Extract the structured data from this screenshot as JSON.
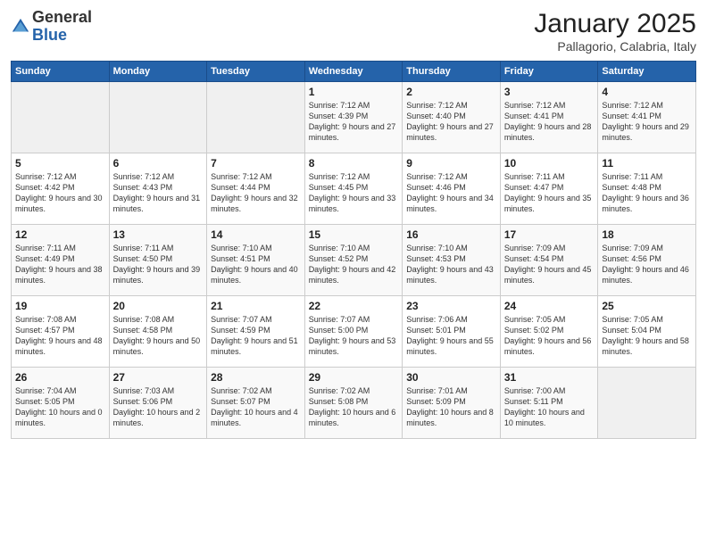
{
  "logo": {
    "general": "General",
    "blue": "Blue"
  },
  "header": {
    "month": "January 2025",
    "location": "Pallagorio, Calabria, Italy"
  },
  "weekdays": [
    "Sunday",
    "Monday",
    "Tuesday",
    "Wednesday",
    "Thursday",
    "Friday",
    "Saturday"
  ],
  "weeks": [
    [
      {
        "day": "",
        "info": ""
      },
      {
        "day": "",
        "info": ""
      },
      {
        "day": "",
        "info": ""
      },
      {
        "day": "1",
        "info": "Sunrise: 7:12 AM\nSunset: 4:39 PM\nDaylight: 9 hours\nand 27 minutes."
      },
      {
        "day": "2",
        "info": "Sunrise: 7:12 AM\nSunset: 4:40 PM\nDaylight: 9 hours\nand 27 minutes."
      },
      {
        "day": "3",
        "info": "Sunrise: 7:12 AM\nSunset: 4:41 PM\nDaylight: 9 hours\nand 28 minutes."
      },
      {
        "day": "4",
        "info": "Sunrise: 7:12 AM\nSunset: 4:41 PM\nDaylight: 9 hours\nand 29 minutes."
      }
    ],
    [
      {
        "day": "5",
        "info": "Sunrise: 7:12 AM\nSunset: 4:42 PM\nDaylight: 9 hours\nand 30 minutes."
      },
      {
        "day": "6",
        "info": "Sunrise: 7:12 AM\nSunset: 4:43 PM\nDaylight: 9 hours\nand 31 minutes."
      },
      {
        "day": "7",
        "info": "Sunrise: 7:12 AM\nSunset: 4:44 PM\nDaylight: 9 hours\nand 32 minutes."
      },
      {
        "day": "8",
        "info": "Sunrise: 7:12 AM\nSunset: 4:45 PM\nDaylight: 9 hours\nand 33 minutes."
      },
      {
        "day": "9",
        "info": "Sunrise: 7:12 AM\nSunset: 4:46 PM\nDaylight: 9 hours\nand 34 minutes."
      },
      {
        "day": "10",
        "info": "Sunrise: 7:11 AM\nSunset: 4:47 PM\nDaylight: 9 hours\nand 35 minutes."
      },
      {
        "day": "11",
        "info": "Sunrise: 7:11 AM\nSunset: 4:48 PM\nDaylight: 9 hours\nand 36 minutes."
      }
    ],
    [
      {
        "day": "12",
        "info": "Sunrise: 7:11 AM\nSunset: 4:49 PM\nDaylight: 9 hours\nand 38 minutes."
      },
      {
        "day": "13",
        "info": "Sunrise: 7:11 AM\nSunset: 4:50 PM\nDaylight: 9 hours\nand 39 minutes."
      },
      {
        "day": "14",
        "info": "Sunrise: 7:10 AM\nSunset: 4:51 PM\nDaylight: 9 hours\nand 40 minutes."
      },
      {
        "day": "15",
        "info": "Sunrise: 7:10 AM\nSunset: 4:52 PM\nDaylight: 9 hours\nand 42 minutes."
      },
      {
        "day": "16",
        "info": "Sunrise: 7:10 AM\nSunset: 4:53 PM\nDaylight: 9 hours\nand 43 minutes."
      },
      {
        "day": "17",
        "info": "Sunrise: 7:09 AM\nSunset: 4:54 PM\nDaylight: 9 hours\nand 45 minutes."
      },
      {
        "day": "18",
        "info": "Sunrise: 7:09 AM\nSunset: 4:56 PM\nDaylight: 9 hours\nand 46 minutes."
      }
    ],
    [
      {
        "day": "19",
        "info": "Sunrise: 7:08 AM\nSunset: 4:57 PM\nDaylight: 9 hours\nand 48 minutes."
      },
      {
        "day": "20",
        "info": "Sunrise: 7:08 AM\nSunset: 4:58 PM\nDaylight: 9 hours\nand 50 minutes."
      },
      {
        "day": "21",
        "info": "Sunrise: 7:07 AM\nSunset: 4:59 PM\nDaylight: 9 hours\nand 51 minutes."
      },
      {
        "day": "22",
        "info": "Sunrise: 7:07 AM\nSunset: 5:00 PM\nDaylight: 9 hours\nand 53 minutes."
      },
      {
        "day": "23",
        "info": "Sunrise: 7:06 AM\nSunset: 5:01 PM\nDaylight: 9 hours\nand 55 minutes."
      },
      {
        "day": "24",
        "info": "Sunrise: 7:05 AM\nSunset: 5:02 PM\nDaylight: 9 hours\nand 56 minutes."
      },
      {
        "day": "25",
        "info": "Sunrise: 7:05 AM\nSunset: 5:04 PM\nDaylight: 9 hours\nand 58 minutes."
      }
    ],
    [
      {
        "day": "26",
        "info": "Sunrise: 7:04 AM\nSunset: 5:05 PM\nDaylight: 10 hours\nand 0 minutes."
      },
      {
        "day": "27",
        "info": "Sunrise: 7:03 AM\nSunset: 5:06 PM\nDaylight: 10 hours\nand 2 minutes."
      },
      {
        "day": "28",
        "info": "Sunrise: 7:02 AM\nSunset: 5:07 PM\nDaylight: 10 hours\nand 4 minutes."
      },
      {
        "day": "29",
        "info": "Sunrise: 7:02 AM\nSunset: 5:08 PM\nDaylight: 10 hours\nand 6 minutes."
      },
      {
        "day": "30",
        "info": "Sunrise: 7:01 AM\nSunset: 5:09 PM\nDaylight: 10 hours\nand 8 minutes."
      },
      {
        "day": "31",
        "info": "Sunrise: 7:00 AM\nSunset: 5:11 PM\nDaylight: 10 hours\nand 10 minutes."
      },
      {
        "day": "",
        "info": ""
      }
    ]
  ]
}
